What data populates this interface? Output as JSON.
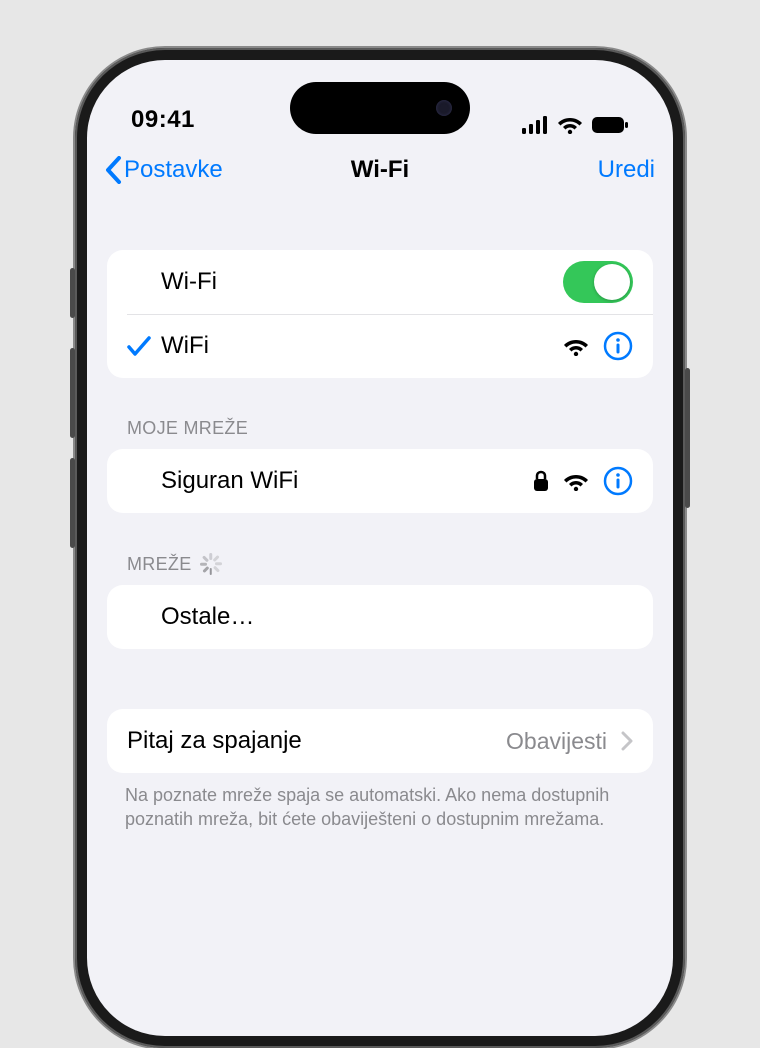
{
  "status": {
    "time": "09:41"
  },
  "nav": {
    "back": "Postavke",
    "title": "Wi-Fi",
    "edit": "Uredi"
  },
  "wifi": {
    "toggle_label": "Wi-Fi",
    "toggle_on": true,
    "connected_network": "WiFi"
  },
  "sections": {
    "my_networks_header": "MOJE MREŽE",
    "my_networks": [
      {
        "name": "Siguran WiFi",
        "secured": true
      }
    ],
    "other_networks_header": "MREŽE",
    "other_label": "Ostale…"
  },
  "ask_to_join": {
    "label": "Pitaj za spajanje",
    "value": "Obavijesti",
    "footer": "Na poznate mreže spaja se automatski. Ako nema dostupnih poznatih mreža, bit ćete obaviješteni o dostupnim mrežama."
  },
  "colors": {
    "tint": "#007aff",
    "toggle_on": "#34c759"
  }
}
